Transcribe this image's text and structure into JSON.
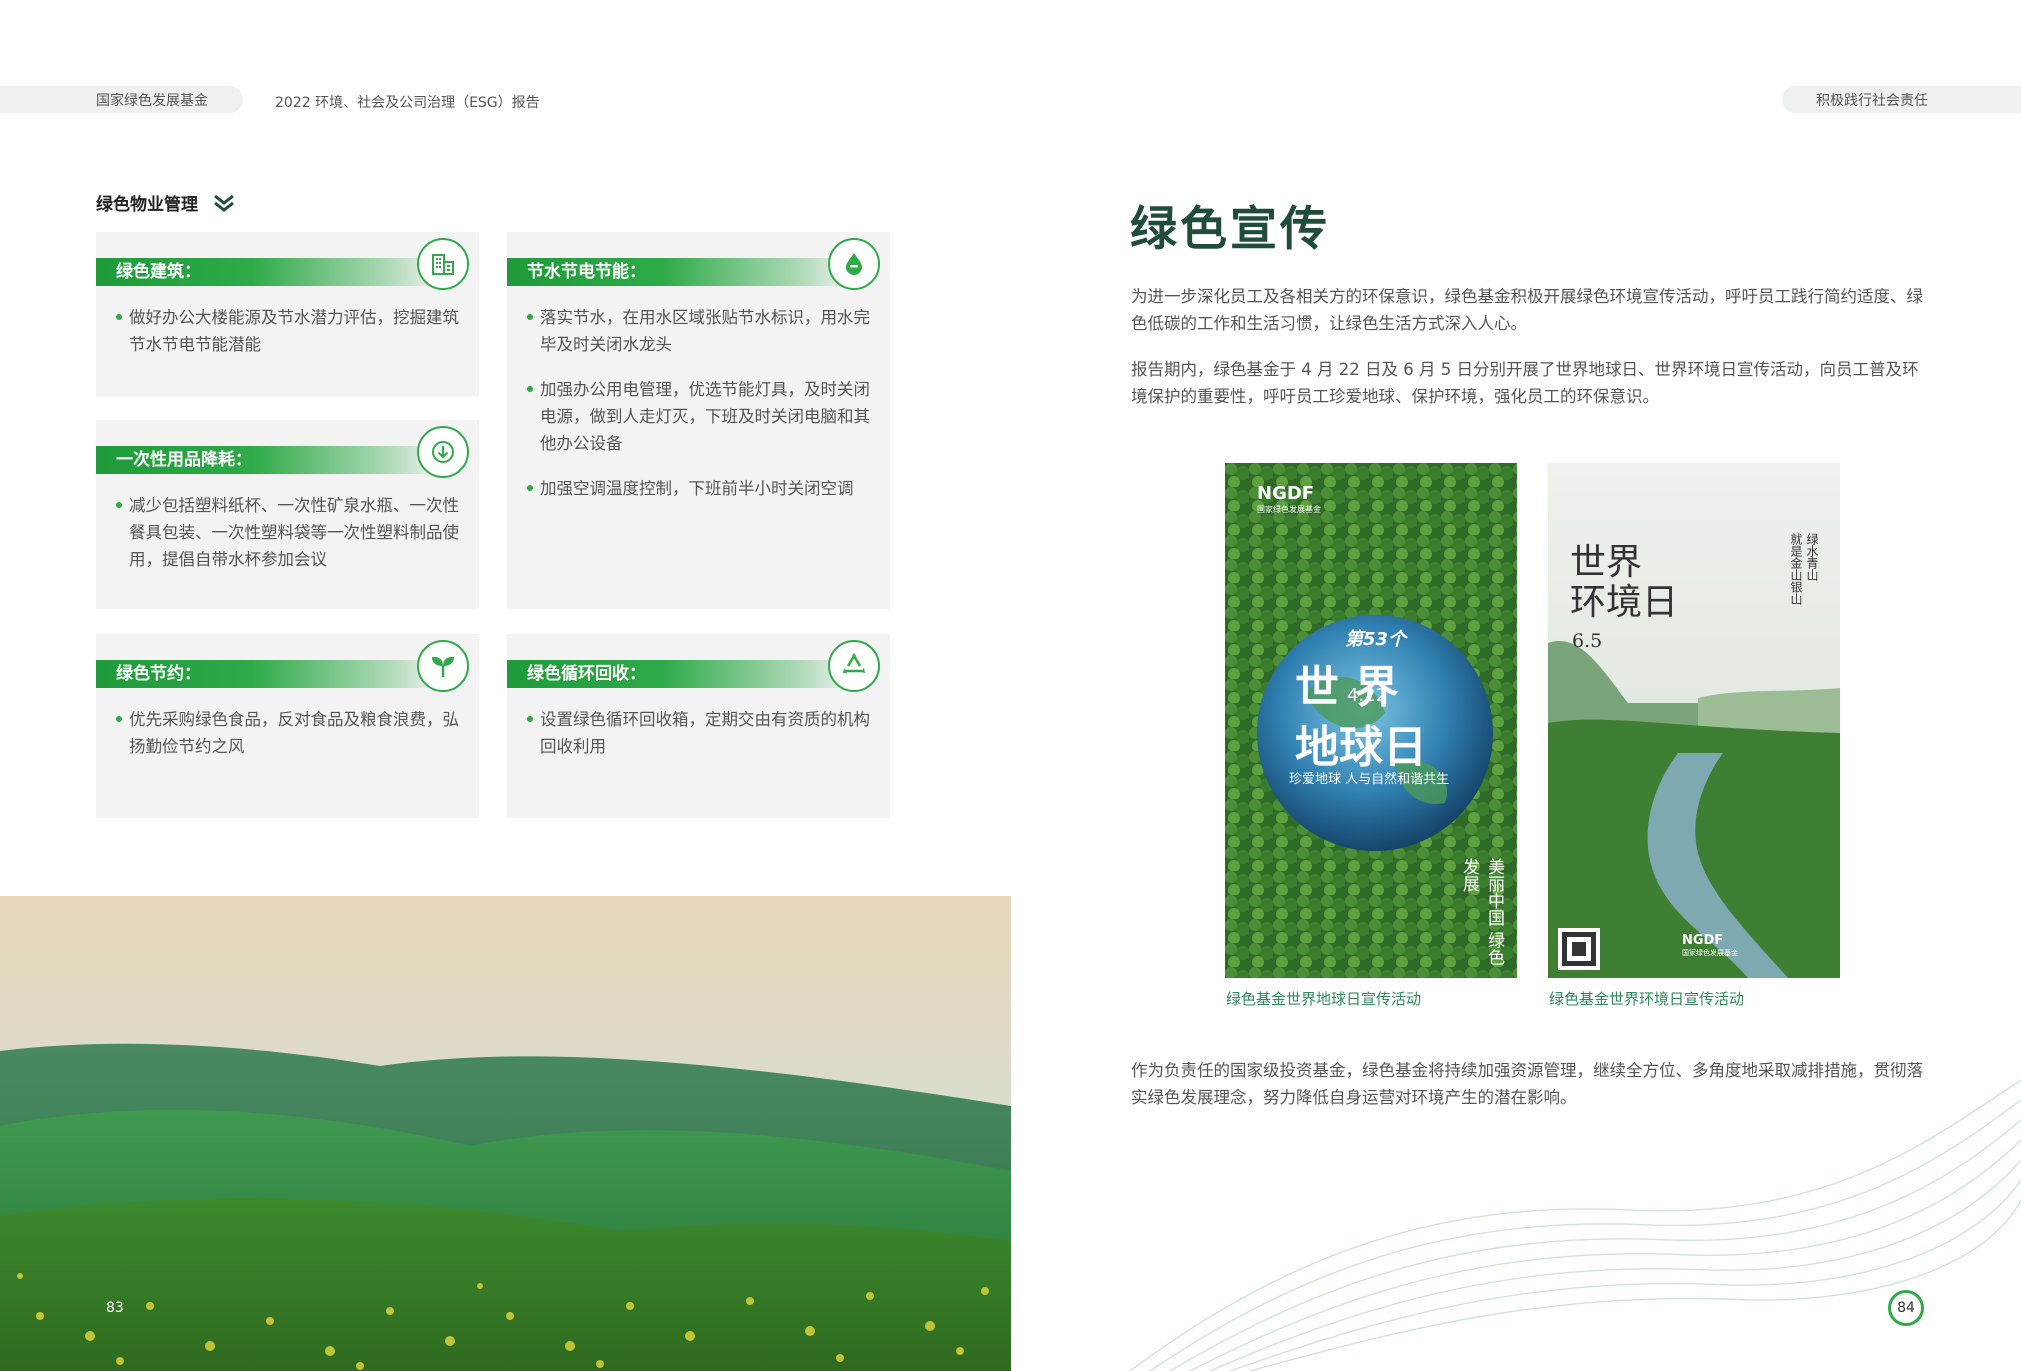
{
  "header": {
    "org": "国家绿色发展基金",
    "report": "2022  环境、社会及公司治理（ESG）报告",
    "chapter": "积极践行社会责任"
  },
  "left": {
    "section_title": "绿色物业管理",
    "cards": [
      {
        "label": "绿色建筑：",
        "icon": "building-icon",
        "items": [
          "做好办公大楼能源及节水潜力评估，挖掘建筑节水节电节能潜能"
        ]
      },
      {
        "label": "一次性用品降耗：",
        "icon": "arrow-down-icon",
        "items": [
          "减少包括塑料纸杯、一次性矿泉水瓶、一次性餐具包装、一次性塑料袋等一次性塑料制品使用，提倡自带水杯参加会议"
        ]
      },
      {
        "label": "节水节电节能：",
        "icon": "water-drop-icon",
        "items": [
          "落实节水，在用水区域张贴节水标识，用水完毕及时关闭水龙头",
          "加强办公用电管理，优选节能灯具，及时关闭电源，做到人走灯灭，下班及时关闭电脑和其他办公设备",
          "加强空调温度控制，下班前半小时关闭空调"
        ]
      },
      {
        "label": "绿色节约：",
        "icon": "sprout-icon",
        "items": [
          "优先采购绿色食品，反对食品及粮食浪费，弘扬勤俭节约之风"
        ]
      },
      {
        "label": "绿色循环回收：",
        "icon": "recycle-icon",
        "items": [
          "设置绿色循环回收箱，定期交由有资质的机构回收利用"
        ]
      }
    ],
    "page_number": "83"
  },
  "right": {
    "title": "绿色宣传",
    "para1": "为进一步深化员工及各相关方的环保意识，绿色基金积极开展绿色环境宣传活动，呼吁员工践行简约适度、绿色低碳的工作和生活习惯，让绿色生活方式深入人心。",
    "para2": "报告期内，绿色基金于 4 月 22 日及 6 月 5 日分别开展了世界地球日、世界环境日宣传活动，向员工普及环境保护的重要性，呼吁员工珍爱地球、保护环境，强化员工的环保意识。",
    "para3": "作为负责任的国家级投资基金，绿色基金将持续加强资源管理，继续全方位、多角度地采取减排措施，贯彻落实绿色发展理念，努力降低自身运营对环境产生的潜在影响。",
    "poster1": {
      "brand": "NGDF",
      "brand_sub": "国家绿色发展基金",
      "top": "第53个",
      "date": "4.22",
      "line1": "世  界",
      "line2": "地球日",
      "slogan": "珍爱地球 人与自然和谐共生",
      "calligraphy": "美丽中国 绿色发展",
      "caption": "绿色基金世界地球日宣传活动"
    },
    "poster2": {
      "title1": "世界",
      "title2": "环境日",
      "date": "6.5",
      "vertical1": "绿水青山",
      "vertical2": "就是金山银山",
      "brand": "NGDF",
      "brand_sub": "国家绿色发展基金",
      "caption": "绿色基金世界环境日宣传活动"
    },
    "page_number": "84"
  },
  "colors": {
    "accent": "#2eaa48",
    "title": "#1f4d3a",
    "caption": "#2e8a5a",
    "card_bg": "#f2f3f2"
  }
}
